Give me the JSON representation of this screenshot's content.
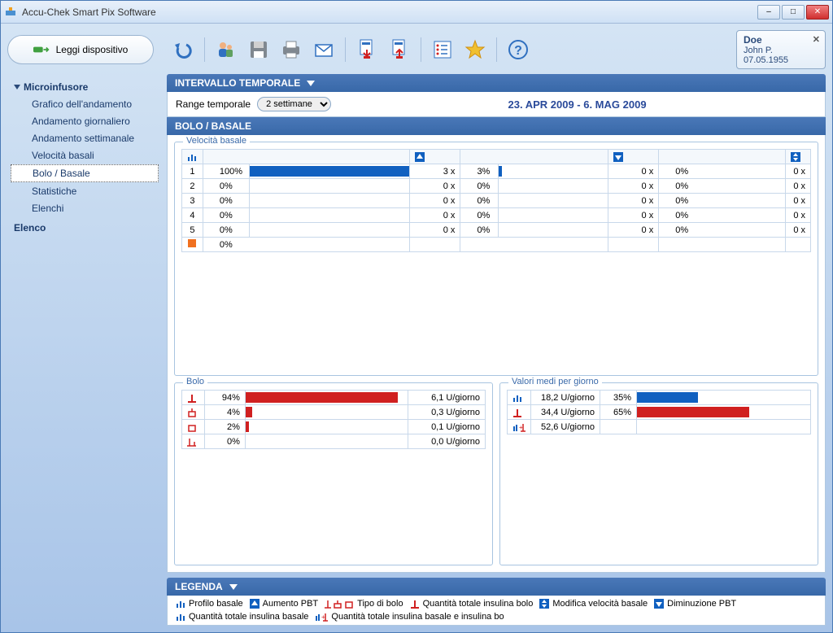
{
  "window": {
    "title": "Accu-Chek Smart Pix Software"
  },
  "toolbar": {
    "read_device": "Leggi dispositivo"
  },
  "patient": {
    "surname": "Doe",
    "firstname": "John P.",
    "dob": "07.05.1955"
  },
  "nav": {
    "group1": "Microinfusore",
    "items": [
      "Grafico dell'andamento",
      "Andamento giornaliero",
      "Andamento settimanale",
      "Velocità basali",
      "Bolo / Basale",
      "Statistiche",
      "Elenchi"
    ],
    "group2": "Elenco"
  },
  "section": {
    "interval_title": "INTERVALLO TEMPORALE",
    "range_label": "Range temporale",
    "range_value": "2 settimane",
    "date_range": "23. APR 2009 - 6. MAG 2009",
    "bolo_basale": "BOLO / BASALE"
  },
  "panels": {
    "basal": {
      "title": "Velocità basale",
      "rows": [
        {
          "idx": "1",
          "pct": "100%",
          "bar": 100,
          "a_x": "3 x",
          "a_pct": "3%",
          "a_bar": 3,
          "b_x": "0 x",
          "b_pct": "0%",
          "c_x": "0 x"
        },
        {
          "idx": "2",
          "pct": "0%",
          "bar": 0,
          "a_x": "0 x",
          "a_pct": "0%",
          "a_bar": 0,
          "b_x": "0 x",
          "b_pct": "0%",
          "c_x": "0 x"
        },
        {
          "idx": "3",
          "pct": "0%",
          "bar": 0,
          "a_x": "0 x",
          "a_pct": "0%",
          "a_bar": 0,
          "b_x": "0 x",
          "b_pct": "0%",
          "c_x": "0 x"
        },
        {
          "idx": "4",
          "pct": "0%",
          "bar": 0,
          "a_x": "0 x",
          "a_pct": "0%",
          "a_bar": 0,
          "b_x": "0 x",
          "b_pct": "0%",
          "c_x": "0 x"
        },
        {
          "idx": "5",
          "pct": "0%",
          "bar": 0,
          "a_x": "0 x",
          "a_pct": "0%",
          "a_bar": 0,
          "b_x": "0 x",
          "b_pct": "0%",
          "c_x": "0 x"
        }
      ],
      "last_pct": "0%"
    },
    "bolo": {
      "title": "Bolo",
      "rows": [
        {
          "pct": "94%",
          "bar": 94,
          "val": "6,1 U/giorno"
        },
        {
          "pct": "4%",
          "bar": 4,
          "val": "0,3 U/giorno"
        },
        {
          "pct": "2%",
          "bar": 2,
          "val": "0,1 U/giorno"
        },
        {
          "pct": "0%",
          "bar": 0,
          "val": "0,0 U/giorno"
        }
      ]
    },
    "avg": {
      "title": "Valori medi per giorno",
      "row1": {
        "val": "18,2 U/giorno",
        "pct": "35%",
        "bar": 35,
        "color": "#1060c0"
      },
      "row2": {
        "val": "34,4 U/giorno",
        "pct": "65%",
        "bar": 65,
        "color": "#d02020"
      },
      "row3": {
        "val": "52,6 U/giorno"
      }
    }
  },
  "legend": {
    "title": "LEGENDA",
    "items": [
      "Profilo basale",
      "Aumento PBT",
      "Tipo di bolo",
      "Quantità totale insulina bolo",
      "Modifica velocità basale",
      "Diminuzione PBT",
      "Quantità totale insulina basale",
      "Quantità totale insulina basale e insulina bo"
    ]
  },
  "chart_data": {
    "type": "table",
    "basal_rate_profiles": [
      {
        "profile": 1,
        "usage_pct": 100,
        "pbt_increase_count": 3,
        "pbt_increase_pct": 3,
        "pbt_decrease_count": 0,
        "pbt_decrease_pct": 0,
        "rate_change_count": 0
      },
      {
        "profile": 2,
        "usage_pct": 0,
        "pbt_increase_count": 0,
        "pbt_increase_pct": 0,
        "pbt_decrease_count": 0,
        "pbt_decrease_pct": 0,
        "rate_change_count": 0
      },
      {
        "profile": 3,
        "usage_pct": 0,
        "pbt_increase_count": 0,
        "pbt_increase_pct": 0,
        "pbt_decrease_count": 0,
        "pbt_decrease_pct": 0,
        "rate_change_count": 0
      },
      {
        "profile": 4,
        "usage_pct": 0,
        "pbt_increase_count": 0,
        "pbt_increase_pct": 0,
        "pbt_decrease_count": 0,
        "pbt_decrease_pct": 0,
        "rate_change_count": 0
      },
      {
        "profile": 5,
        "usage_pct": 0,
        "pbt_increase_count": 0,
        "pbt_increase_pct": 0,
        "pbt_decrease_count": 0,
        "pbt_decrease_pct": 0,
        "rate_change_count": 0
      }
    ],
    "bolus_types": [
      {
        "pct": 94,
        "u_per_day": 6.1
      },
      {
        "pct": 4,
        "u_per_day": 0.3
      },
      {
        "pct": 2,
        "u_per_day": 0.1
      },
      {
        "pct": 0,
        "u_per_day": 0.0
      }
    ],
    "avg_per_day": {
      "basal_u_day": 18.2,
      "basal_pct": 35,
      "bolus_u_day": 34.4,
      "bolus_pct": 65,
      "total_u_day": 52.6
    }
  }
}
